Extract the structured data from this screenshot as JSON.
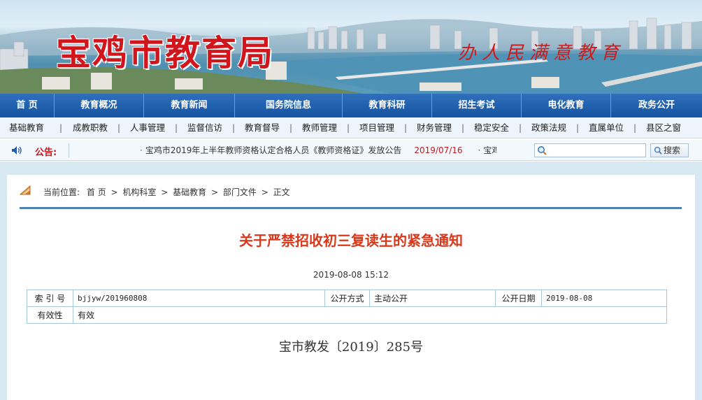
{
  "banner": {
    "title": "宝鸡市教育局",
    "slogan": "办人民满意教育"
  },
  "main_nav": [
    {
      "label": "首 页"
    },
    {
      "label": "教育概况"
    },
    {
      "label": "教育新闻"
    },
    {
      "label": "国务院信息"
    },
    {
      "label": "教育科研"
    },
    {
      "label": "招生考试"
    },
    {
      "label": "电化教育"
    },
    {
      "label": "政务公开"
    }
  ],
  "sub_nav": [
    {
      "label": "基础教育"
    },
    {
      "label": "成教职教"
    },
    {
      "label": "人事管理"
    },
    {
      "label": "监督信访"
    },
    {
      "label": "教育督导"
    },
    {
      "label": "教师管理"
    },
    {
      "label": "项目管理"
    },
    {
      "label": "财务管理"
    },
    {
      "label": "稳定安全"
    },
    {
      "label": "政策法规"
    },
    {
      "label": "直属单位"
    },
    {
      "label": "县区之窗"
    }
  ],
  "sub_nav_separator": "|",
  "notice": {
    "label": "公告:",
    "bullet": "·",
    "item_text": "宝鸡市2019年上半年教师资格认定合格人员《教师资格证》发放公告",
    "item_date": "2019/07/16",
    "next_text": "宝鸡市",
    "speaker_icon": "speaker-icon"
  },
  "search": {
    "placeholder": "",
    "button_label": "搜索"
  },
  "breadcrumb": {
    "prefix": "当前位置:",
    "items": [
      "首 页",
      "机构科室",
      "基础教育",
      "部门文件",
      "正文"
    ],
    "separator": ">"
  },
  "article": {
    "title": "关于严禁招收初三复读生的紧急通知",
    "date": "2019-08-08 15:12",
    "doc_number": "宝市教发〔2019〕285号"
  },
  "meta": {
    "index_label": "索 引 号",
    "index_value": "bjjyw/201960808",
    "open_mode_label": "公开方式",
    "open_mode_value": "主动公开",
    "open_date_label": "公开日期",
    "open_date_value": "2019-08-08",
    "validity_label": "有效性",
    "validity_value": "有效"
  },
  "colors": {
    "nav_blue": "#1553a0",
    "accent_red": "#c8161d",
    "title_orange_red": "#d9381a"
  }
}
